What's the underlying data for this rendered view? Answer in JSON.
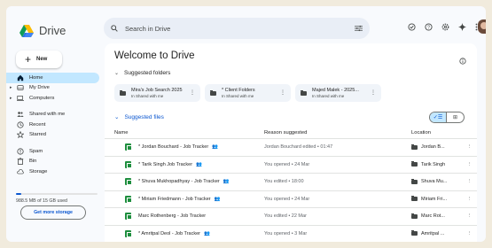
{
  "app": {
    "name": "Drive"
  },
  "search": {
    "placeholder": "Search in Drive"
  },
  "sidebar": {
    "new_label": "New",
    "items": [
      {
        "label": "Home",
        "icon": "home-icon"
      },
      {
        "label": "My Drive",
        "icon": "drive-icon"
      },
      {
        "label": "Computers",
        "icon": "computer-icon"
      },
      {
        "label": "Shared with me",
        "icon": "people-icon"
      },
      {
        "label": "Recent",
        "icon": "clock-icon"
      },
      {
        "label": "Starred",
        "icon": "star-icon"
      },
      {
        "label": "Spam",
        "icon": "spam-icon"
      },
      {
        "label": "Bin",
        "icon": "bin-icon"
      },
      {
        "label": "Storage",
        "icon": "cloud-icon"
      }
    ],
    "storage_text": "988.5 MB of 15 GB used",
    "storage_used_fraction": 0.066,
    "more_storage_label": "Get more storage"
  },
  "main": {
    "title": "Welcome to Drive",
    "suggested_folders_label": "Suggested folders",
    "folders": [
      {
        "name": "Mira's Job Search 2025",
        "location": "In Shared with me"
      },
      {
        "name": "* Client Folders",
        "location": "In Shared with me"
      },
      {
        "name": "Majed Malek - 2025...",
        "location": "In Shared with me"
      }
    ],
    "suggested_files_label": "Suggested files",
    "columns": {
      "name": "Name",
      "reason": "Reason suggested",
      "location": "Location"
    },
    "files": [
      {
        "name": "* Jordan Bouchard - Job Tracker",
        "shared": true,
        "reason": "Jordan Bouchard edited • 01:47",
        "location": "Jordan B..."
      },
      {
        "name": "* Tarik Singh Job Tracker",
        "shared": true,
        "reason": "You opened • 24 Mar",
        "location": "Tarik Singh"
      },
      {
        "name": "* Shuva Mukhopadhyay - Job Tracker",
        "shared": true,
        "reason": "You edited • 18:00",
        "location": "Shuva Mu..."
      },
      {
        "name": "* Miriam Friedmann - Job Tracker",
        "shared": true,
        "reason": "You opened • 24 Mar",
        "location": "Miriam Fri..."
      },
      {
        "name": "Marc Rothenberg - Job Tracker",
        "shared": false,
        "reason": "You edited • 22 Mar",
        "location": "Marc Rot..."
      },
      {
        "name": "* Amritpal Deol - Job Tracker",
        "shared": true,
        "reason": "You opened • 3 Mar",
        "location": "Amritpal ..."
      }
    ]
  },
  "colors": {
    "accent": "#0b57d0",
    "active_nav": "#c2e7ff",
    "sheet_green": "#1e8e3e",
    "page_bg": "#f8fafd"
  }
}
